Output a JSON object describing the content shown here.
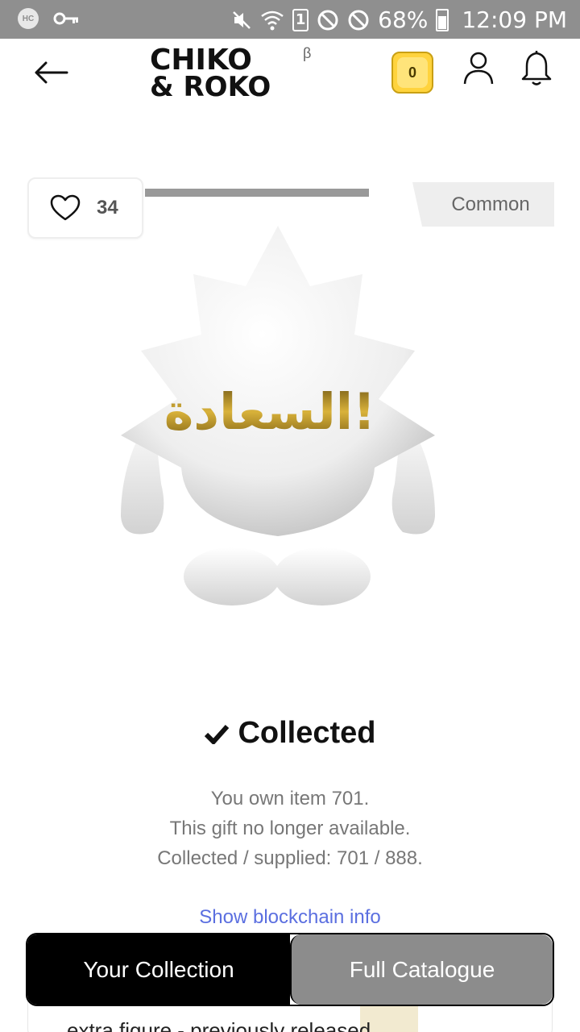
{
  "status_bar": {
    "hc_label": "HC",
    "battery": "68%",
    "sim": "1",
    "time": "12:09 PM",
    "icons": [
      "hc-icon",
      "key-icon",
      "mute-icon",
      "wifi-icon",
      "sim-icon",
      "blocked-icon",
      "blocked-icon",
      "battery-icon"
    ]
  },
  "header": {
    "logo_line1": "CHIKO",
    "logo_line2": "& ROKO",
    "logo_beta": "β",
    "coin_count": "0",
    "icons": [
      "back-arrow-icon",
      "user-icon",
      "bell-icon"
    ]
  },
  "item": {
    "likes": "34",
    "rarity": "Common",
    "progress_fraction": 1.0,
    "figure_text": "السعادة!",
    "status": "Collected",
    "info_lines": [
      "You own item 701.",
      "This gift no longer available.",
      "Collected / supplied: 701 / 888."
    ],
    "blockchain_link": "Show blockchain info",
    "description_partial": "extra figure - previously released"
  },
  "bottom_nav": {
    "your_collection": "Your Collection",
    "full_catalogue": "Full Catalogue"
  },
  "colors": {
    "status_bar": "#8f8f8f",
    "coin": "#ffd33d",
    "link": "#5b6fe0",
    "active_tab": "#000000",
    "inactive_tab": "#8c8c8c"
  }
}
